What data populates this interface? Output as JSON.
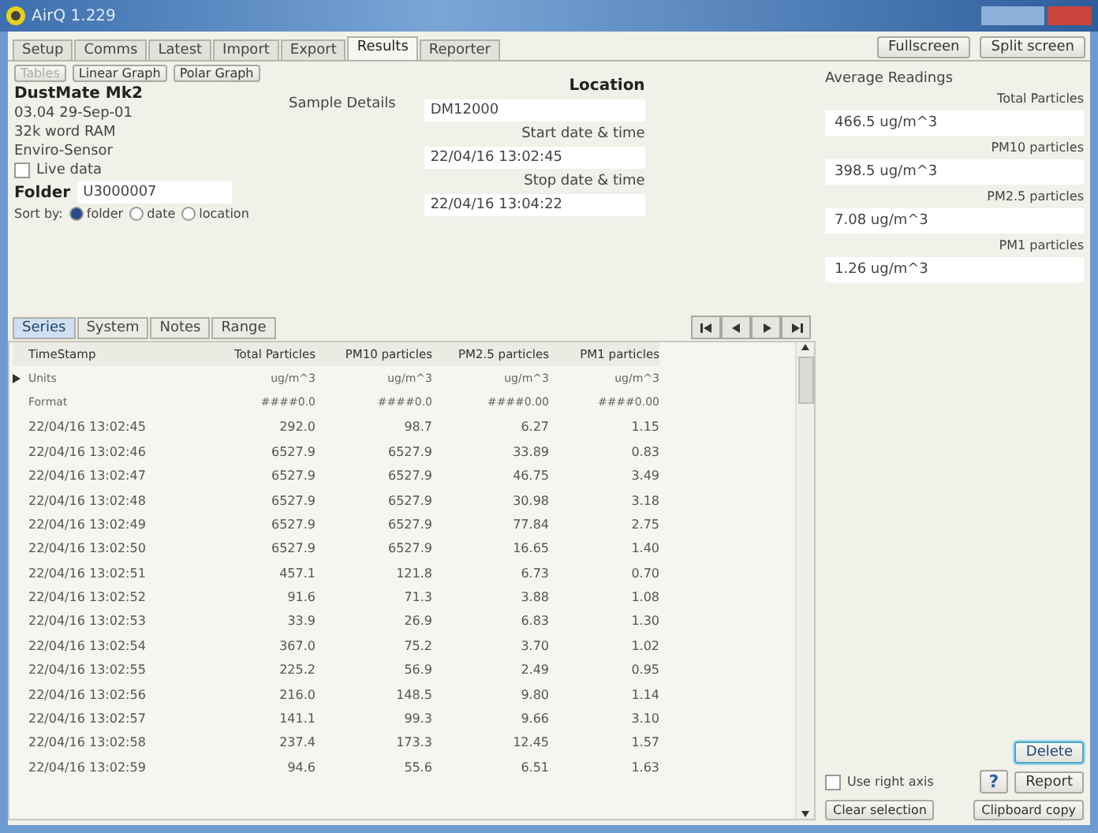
{
  "window": {
    "title": "AirQ 1.229"
  },
  "tabs": [
    {
      "label": "Setup",
      "selected": false
    },
    {
      "label": "Comms",
      "selected": false
    },
    {
      "label": "Latest",
      "selected": false
    },
    {
      "label": "Import",
      "selected": false
    },
    {
      "label": "Export",
      "selected": false
    },
    {
      "label": "Results",
      "selected": true
    },
    {
      "label": "Reporter",
      "selected": false
    }
  ],
  "screen_buttons": [
    "Fullscreen",
    "Split screen"
  ],
  "view_buttons": [
    {
      "label": "Tables",
      "disabled": true
    },
    {
      "label": "Linear Graph",
      "disabled": false
    },
    {
      "label": "Polar Graph",
      "disabled": false
    }
  ],
  "device": {
    "name": "DustMate Mk2",
    "lines": [
      "03.04 29-Sep-01",
      "32k word RAM",
      "Enviro-Sensor"
    ]
  },
  "sample_details": "Sample Details",
  "live_data": {
    "label": "Live data",
    "checked": false
  },
  "folder": {
    "label": "Folder",
    "value": "U3000007"
  },
  "sort_by": {
    "label": "Sort by:",
    "options": [
      {
        "label": "folder",
        "selected": true
      },
      {
        "label": "date",
        "selected": false
      },
      {
        "label": "location",
        "selected": false
      }
    ]
  },
  "location": {
    "label": "Location",
    "value": "DM12000"
  },
  "start": {
    "label": "Start date & time",
    "value": "22/04/16 13:02:45"
  },
  "stop": {
    "label": "Stop date & time",
    "value": "22/04/16 13:04:22"
  },
  "sub_tabs": [
    {
      "label": "Series",
      "selected": true
    },
    {
      "label": "System",
      "selected": false
    },
    {
      "label": "Notes",
      "selected": false
    },
    {
      "label": "Range",
      "selected": false
    }
  ],
  "average": {
    "title": "Average Readings",
    "readings": [
      {
        "label": "Total Particles",
        "value": "466.5 ug/m^3"
      },
      {
        "label": "PM10 particles",
        "value": "398.5 ug/m^3"
      },
      {
        "label": "PM2.5 particles",
        "value": "7.08 ug/m^3"
      },
      {
        "label": "PM1 particles",
        "value": "1.26 ug/m^3"
      }
    ]
  },
  "table": {
    "columns": [
      "TimeStamp",
      "Total Particles",
      "PM10 particles",
      "PM2.5 particles",
      "PM1 particles"
    ],
    "rows": [
      {
        "kind": "units",
        "current": true,
        "cells": [
          "Units",
          "ug/m^3",
          "ug/m^3",
          "ug/m^3",
          "ug/m^3"
        ]
      },
      {
        "kind": "format",
        "current": false,
        "cells": [
          "Format",
          "####0.0",
          "####0.0",
          "####0.00",
          "####0.00"
        ]
      },
      {
        "kind": "data",
        "current": false,
        "cells": [
          "22/04/16 13:02:45",
          "292.0",
          "98.7",
          "6.27",
          "1.15"
        ]
      },
      {
        "kind": "data",
        "current": false,
        "cells": [
          "22/04/16 13:02:46",
          "6527.9",
          "6527.9",
          "33.89",
          "0.83"
        ]
      },
      {
        "kind": "data",
        "current": false,
        "cells": [
          "22/04/16 13:02:47",
          "6527.9",
          "6527.9",
          "46.75",
          "3.49"
        ]
      },
      {
        "kind": "data",
        "current": false,
        "cells": [
          "22/04/16 13:02:48",
          "6527.9",
          "6527.9",
          "30.98",
          "3.18"
        ]
      },
      {
        "kind": "data",
        "current": false,
        "cells": [
          "22/04/16 13:02:49",
          "6527.9",
          "6527.9",
          "77.84",
          "2.75"
        ]
      },
      {
        "kind": "data",
        "current": false,
        "cells": [
          "22/04/16 13:02:50",
          "6527.9",
          "6527.9",
          "16.65",
          "1.40"
        ]
      },
      {
        "kind": "data",
        "current": false,
        "cells": [
          "22/04/16 13:02:51",
          "457.1",
          "121.8",
          "6.73",
          "0.70"
        ]
      },
      {
        "kind": "data",
        "current": false,
        "cells": [
          "22/04/16 13:02:52",
          "91.6",
          "71.3",
          "3.88",
          "1.08"
        ]
      },
      {
        "kind": "data",
        "current": false,
        "cells": [
          "22/04/16 13:02:53",
          "33.9",
          "26.9",
          "6.83",
          "1.30"
        ]
      },
      {
        "kind": "data",
        "current": false,
        "cells": [
          "22/04/16 13:02:54",
          "367.0",
          "75.2",
          "3.70",
          "1.02"
        ]
      },
      {
        "kind": "data",
        "current": false,
        "cells": [
          "22/04/16 13:02:55",
          "225.2",
          "56.9",
          "2.49",
          "0.95"
        ]
      },
      {
        "kind": "data",
        "current": false,
        "cells": [
          "22/04/16 13:02:56",
          "216.0",
          "148.5",
          "9.80",
          "1.14"
        ]
      },
      {
        "kind": "data",
        "current": false,
        "cells": [
          "22/04/16 13:02:57",
          "141.1",
          "99.3",
          "9.66",
          "3.10"
        ]
      },
      {
        "kind": "data",
        "current": false,
        "cells": [
          "22/04/16 13:02:58",
          "237.4",
          "173.3",
          "12.45",
          "1.57"
        ]
      },
      {
        "kind": "data",
        "current": false,
        "cells": [
          "22/04/16 13:02:59",
          "94.6",
          "55.6",
          "6.51",
          "1.63"
        ]
      }
    ]
  },
  "use_right_axis": {
    "label": "Use right axis",
    "checked": false
  },
  "delete_button": "Delete",
  "help_button": "?",
  "report_button": "Report",
  "bottom_buttons": [
    "Clear selection",
    "Clipboard copy"
  ]
}
